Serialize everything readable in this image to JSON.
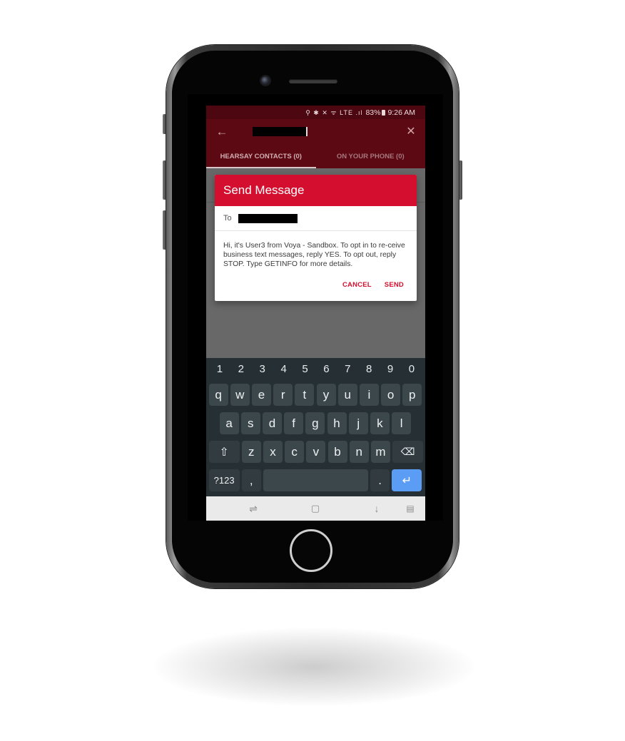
{
  "status_bar": {
    "icons": "⚲ ✱ ✕ ᯤ LTE .ıl",
    "battery": "83%",
    "time": "9:26 AM"
  },
  "app_bar": {
    "back_icon": "arrow-left",
    "search_value": "",
    "close_icon": "close"
  },
  "tabs": [
    {
      "label": "HEARSAY CONTACTS (0)",
      "active": true
    },
    {
      "label": "ON YOUR PHONE (0)",
      "active": false
    }
  ],
  "dialog": {
    "title": "Send Message",
    "to_label": "To",
    "to_value": "",
    "message": "Hi, it's User3 from Voya - Sandbox. To opt in to re-ceive business text messages, reply YES. To opt out, reply STOP. Type GETINFO for more details.",
    "cancel_label": "CANCEL",
    "send_label": "SEND",
    "accent_color": "#d30e2e"
  },
  "keyboard": {
    "numbers": [
      "1",
      "2",
      "3",
      "4",
      "5",
      "6",
      "7",
      "8",
      "9",
      "0"
    ],
    "row1": [
      "q",
      "w",
      "e",
      "r",
      "t",
      "y",
      "u",
      "i",
      "o",
      "p"
    ],
    "row2": [
      "a",
      "s",
      "d",
      "f",
      "g",
      "h",
      "j",
      "k",
      "l"
    ],
    "row3": [
      "z",
      "x",
      "c",
      "v",
      "b",
      "n",
      "m"
    ],
    "symbols_label": "?123",
    "comma_label": ",",
    "period_label": ".",
    "shift_icon": "shift",
    "backspace_icon": "backspace",
    "enter_icon": "enter"
  },
  "nav_bar": {
    "icons": [
      "recent-apps",
      "home",
      "back",
      "keyboard-switch"
    ]
  }
}
